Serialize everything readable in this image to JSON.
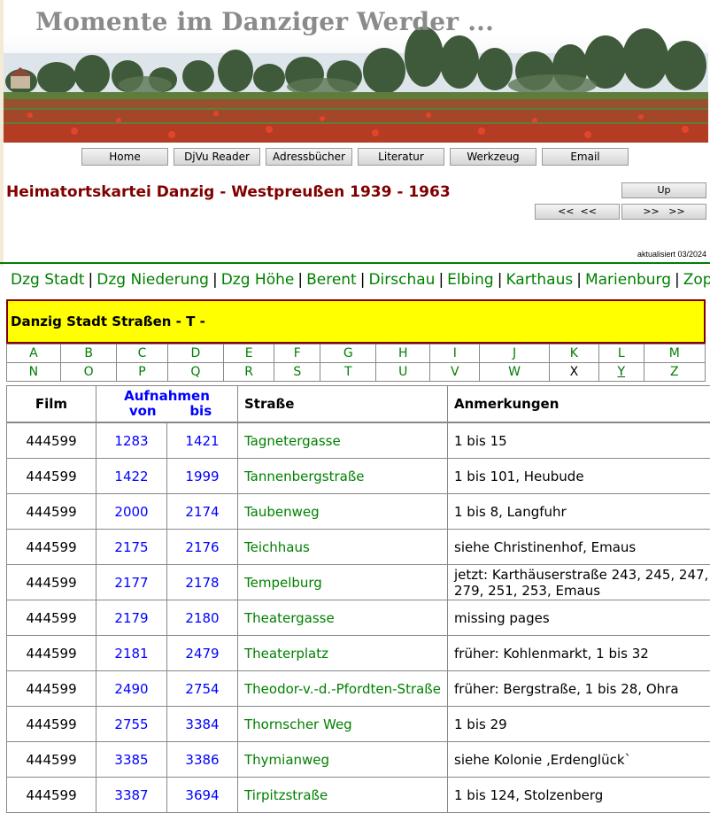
{
  "banner": {
    "title": "Momente im Danziger Werder ..."
  },
  "nav": [
    "Home",
    "DjVu Reader",
    "Adressbücher",
    "Literatur",
    "Werkzeug",
    "Email"
  ],
  "page_title": "Heimatortskartei Danzig - Westpreußen 1939 - 1963",
  "pager": {
    "up": "Up",
    "prev": "<<  <<",
    "next": ">>   >>"
  },
  "updated": "aktualisiert 03/2024",
  "regions": [
    "Dzg Stadt",
    "Dzg Niederung",
    "Dzg Höhe",
    "Berent",
    "Dirschau",
    "Elbing",
    "Karthaus",
    "Marienburg",
    "Zoppot"
  ],
  "section_heading": "Danzig Stadt Straßen - T -",
  "letters_row1": [
    "A",
    "B",
    "C",
    "D",
    "E",
    "F",
    "G",
    "H",
    "I",
    "J",
    "K",
    "L",
    "M"
  ],
  "letters_row2": [
    "N",
    "O",
    "P",
    "Q",
    "R",
    "S",
    "T",
    "U",
    "V",
    "W",
    "X",
    "Y",
    "Z"
  ],
  "table": {
    "headers": {
      "film": "Film",
      "aufnahmen": "Aufnahmen",
      "von": "von",
      "bis": "bis",
      "strasse": "Straße",
      "anmerkungen": "Anmerkungen"
    },
    "rows": [
      {
        "film": "444599",
        "von": "1283",
        "bis": "1421",
        "strasse": "Tagnetergasse",
        "anm": "1 bis 15"
      },
      {
        "film": "444599",
        "von": "1422",
        "bis": "1999",
        "strasse": "Tannenbergstraße",
        "anm": "1 bis 101, Heubude"
      },
      {
        "film": "444599",
        "von": "2000",
        "bis": "2174",
        "strasse": "Taubenweg",
        "anm": "1 bis 8, Langfuhr"
      },
      {
        "film": "444599",
        "von": "2175",
        "bis": "2176",
        "strasse": "Teichhaus",
        "anm": "siehe Christinenhof, Emaus"
      },
      {
        "film": "444599",
        "von": "2177",
        "bis": "2178",
        "strasse": "Tempelburg",
        "anm": "jetzt: Karthäuserstraße 243, 245, 247, 279, 251, 253, Emaus"
      },
      {
        "film": "444599",
        "von": "2179",
        "bis": "2180",
        "strasse": "Theatergasse",
        "anm": "missing pages"
      },
      {
        "film": "444599",
        "von": "2181",
        "bis": "2479",
        "strasse": "Theaterplatz",
        "anm": "früher: Kohlenmarkt, 1 bis 32"
      },
      {
        "film": "444599",
        "von": "2490",
        "bis": "2754",
        "strasse": "Theodor-v.-d.-Pfordten-Straße",
        "anm": "früher: Bergstraße, 1 bis 28, Ohra"
      },
      {
        "film": "444599",
        "von": "2755",
        "bis": "3384",
        "strasse": "Thornscher Weg",
        "anm": "1 bis 29"
      },
      {
        "film": "444599",
        "von": "3385",
        "bis": "3386",
        "strasse": "Thymianweg",
        "anm": "siehe Kolonie ‚Erdenglück`"
      },
      {
        "film": "444599",
        "von": "3387",
        "bis": "3694",
        "strasse": "Tirpitzstraße",
        "anm": "1 bis 124, Stolzenberg"
      }
    ]
  }
}
